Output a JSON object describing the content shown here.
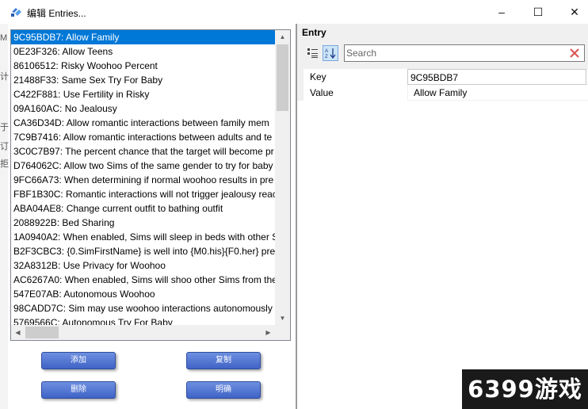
{
  "window": {
    "title": "编辑 Entries...",
    "controls": {
      "minimize": "–",
      "maximize": "☐",
      "close": "✕"
    }
  },
  "left_strip_glyphs": [
    "M",
    "计",
    "于",
    "订",
    "拒"
  ],
  "list": {
    "selected_index": 0,
    "items": [
      "9C95BDB7: Allow Family",
      "0E23F326: Allow Teens",
      "86106512: Risky Woohoo Percent",
      "21488F33: Same Sex Try For Baby",
      "C422F881: Use Fertility in Risky",
      "09A160AC: No Jealousy",
      "CA36D34D: Allow romantic interactions between family mem",
      "7C9B7416: Allow romantic interactions between adults and te",
      "3C0C7B97: The percent chance that the target will become pr",
      "D764062C: Allow two Sims of the same gender to try for baby",
      "9FC66A73: When determining if normal woohoo results in pre",
      "FBF1B30C: Romantic interactions will not trigger jealousy reac",
      "ABA04AE8: Change current outfit to bathing outfit",
      "2088922B: Bed Sharing",
      "1A0940A2: When enabled, Sims will sleep in beds with other S",
      "B2F3CBC3: {0.SimFirstName} is well into {M0.his}{F0.her} pregr",
      "32A8312B: Use Privacy for Woohoo",
      "AC6267A0: When enabled, Sims will shoo other Sims from the",
      "547E07AB: Autonomous Woohoo",
      "98CADD7C: Sim may use woohoo interactions autonomously",
      "5769566C: Autonomous Try For Baby"
    ],
    "scroll_arrows": {
      "up": "▲",
      "down": "▼",
      "left": "◀",
      "right": "▶"
    }
  },
  "buttons": {
    "add": "添加",
    "copy": "复制",
    "delete": "删除",
    "ok": "明确"
  },
  "entry": {
    "header": "Entry",
    "search_placeholder": "Search",
    "rows": [
      {
        "key": "Key",
        "value": "9C95BDB7"
      },
      {
        "key": "Value",
        "value": "Allow Family"
      }
    ]
  },
  "watermark": "6399游戏",
  "colors": {
    "selection": "#0078d7",
    "button_blue": "#3f63c6",
    "panel_bg": "#f0f0f0",
    "clear_icon": "#d9534f"
  }
}
